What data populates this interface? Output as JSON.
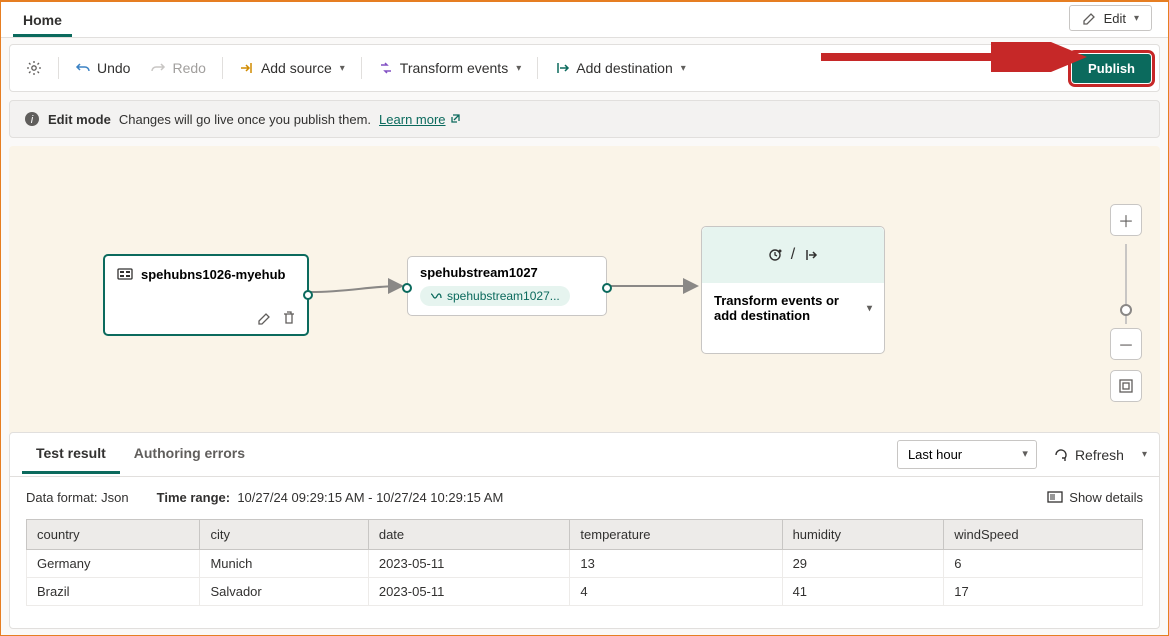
{
  "tabs": {
    "home": "Home"
  },
  "edit_button": "Edit",
  "toolbar": {
    "undo": "Undo",
    "redo": "Redo",
    "add_source": "Add source",
    "transform": "Transform events",
    "add_destination": "Add destination",
    "publish": "Publish"
  },
  "banner": {
    "mode": "Edit mode",
    "msg": "Changes will go live once you publish them.",
    "learn_more": "Learn more"
  },
  "nodes": {
    "source_title": "spehubns1026-myehub",
    "stream_title": "spehubstream1027",
    "stream_pill": "spehubstream1027...",
    "dest_text": "Transform events or add destination"
  },
  "panel": {
    "tabs": {
      "test_result": "Test result",
      "authoring_errors": "Authoring errors"
    },
    "time_select": "Last hour",
    "refresh": "Refresh",
    "data_format_label": "Data format:",
    "data_format_value": "Json",
    "time_range_label": "Time range:",
    "time_range_value": "10/27/24 09:29:15 AM - 10/27/24 10:29:15 AM",
    "show_details": "Show details",
    "columns": [
      "country",
      "city",
      "date",
      "temperature",
      "humidity",
      "windSpeed"
    ],
    "rows": [
      {
        "country": "Germany",
        "city": "Munich",
        "date": "2023-05-11",
        "temperature": "13",
        "humidity": "29",
        "windSpeed": "6"
      },
      {
        "country": "Brazil",
        "city": "Salvador",
        "date": "2023-05-11",
        "temperature": "4",
        "humidity": "41",
        "windSpeed": "17"
      }
    ]
  }
}
